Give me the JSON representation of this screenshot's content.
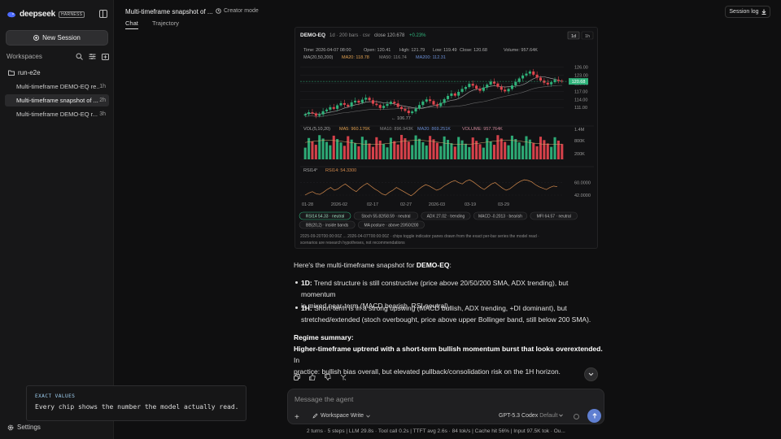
{
  "app": {
    "name": "deepseek",
    "badge": "HARNESS"
  },
  "sidebar": {
    "new_session": "New Session",
    "workspaces_label": "Workspaces",
    "folder": "run-e2e",
    "sessions": [
      {
        "title": "Multi-timeframe DEMO-EQ re...",
        "age": "1h",
        "active": false
      },
      {
        "title": "Multi-timeframe snapshot of ...",
        "age": "2h",
        "active": true
      },
      {
        "title": "Multi-timeframe DEMO-EQ r...",
        "age": "3h",
        "active": false
      }
    ],
    "settings": "Settings"
  },
  "header": {
    "title": "Multi-timeframe snapshot of ...",
    "creator_mode": "Creator mode",
    "tabs": [
      "Chat",
      "Trajectory"
    ],
    "session_log": "Session log"
  },
  "chart_data": {
    "type": "candlestick",
    "symbol": "DEMO-EQ",
    "meta": "1d · 200 bars · csv",
    "close_label": "close 120.678",
    "change": "+0.23%",
    "timeframes": [
      "1d",
      "1h"
    ],
    "info_row1": {
      "time": "Time: 2026-04-07 08:00",
      "open": "Open: 120.41",
      "high": "High: 121.79",
      "low": "Low: 119.49",
      "close": "Close: 120.68",
      "volume": "Volume: 957.64K"
    },
    "info_row2": {
      "ma": "MA(20,50,200)",
      "ma20": "MA20: 118.78",
      "ma50": "MA50: 116.74",
      "ma200": "MA200: 112.31"
    },
    "price_ticks": [
      "126.00",
      "123.00",
      "120.00",
      "117.00",
      "114.00",
      "111.00"
    ],
    "last_price": "120.68",
    "low_marker": "106.77",
    "volume_header": {
      "label": "VOL(5,10,20)",
      "ma5": "MA5: 960.176K",
      "ma10": "MA10: 896.943K",
      "ma20": "MA20: 869.251K",
      "volume": "VOLUME: 957.764K"
    },
    "volume_ticks": [
      "1.4M",
      "800K",
      "200K"
    ],
    "rsi_header": {
      "label": "RSI14°",
      "value": "RSI14: 54.3300"
    },
    "rsi_ticks": [
      "60.0000",
      "42.0000"
    ],
    "x_ticks": [
      "01-28",
      "2026-02",
      "02-17",
      "02-27",
      "2026-03",
      "03-19",
      "03-29"
    ],
    "close_series": [
      108.5,
      109.2,
      108.8,
      107.9,
      108.4,
      109.6,
      110.2,
      111.1,
      110.5,
      111.8,
      112.6,
      112.0,
      111.4,
      112.9,
      113.5,
      112.8,
      113.9,
      114.6,
      113.7,
      112.4,
      111.9,
      110.8,
      111.6,
      112.3,
      113.1,
      112.5,
      111.2,
      110.4,
      109.8,
      108.9,
      109.5,
      110.6,
      111.9,
      113.2,
      114.0,
      113.4,
      112.1,
      111.5,
      112.7,
      114.1,
      115.3,
      116.2,
      115.4,
      116.8,
      117.9,
      118.6,
      119.8,
      119.1,
      118.0,
      117.2,
      118.4,
      119.5,
      120.6,
      119.9,
      118.7,
      117.6,
      117.0,
      117.9,
      119.2,
      120.5,
      121.8,
      122.9,
      123.6,
      124.4,
      123.2,
      122.1,
      121.0,
      120.2,
      119.6,
      120.4,
      121.3,
      120.9,
      120.7
    ],
    "rsi_series": [
      42,
      45,
      47,
      44,
      43,
      46,
      50,
      53,
      49,
      51,
      55,
      58,
      54,
      50,
      47,
      52,
      56,
      59,
      55,
      51,
      48,
      44,
      42,
      46,
      49,
      53,
      50,
      47,
      44,
      41,
      45,
      50,
      54,
      57,
      55,
      52,
      49,
      51,
      55,
      58,
      61,
      63,
      60,
      58,
      62,
      64,
      61,
      57,
      53,
      50,
      54,
      58,
      60,
      56,
      52,
      49,
      51,
      55,
      59,
      62,
      64,
      63,
      61,
      57,
      54,
      52,
      50,
      53,
      55,
      54
    ],
    "chips": [
      {
        "text": "RSI14 54.33 · neutral",
        "accent": "#2fb27a"
      },
      {
        "text": "Stoch 55.82/58.59 · neutral",
        "accent": "#555"
      },
      {
        "text": "ADX 27.02 · trending",
        "accent": "#555"
      },
      {
        "text": "MACD -0.2013 · bearish",
        "accent": "#555"
      },
      {
        "text": "MFI 64.57 · neutral",
        "accent": "#555"
      },
      {
        "text": "BB(20,2) · inside bands",
        "accent": "#555"
      },
      {
        "text": "MA posture · above 20/50/200",
        "accent": "#555"
      }
    ],
    "footnote1": "2025-09-20T00:00:00Z ... 2026-04-07T00:00:00Z · chips toggle indicator panes drawn from the exact per-bar series the model read ·",
    "footnote2": "scenarios are research hypotheses, not recommendations",
    "colors": {
      "up": "#2fb27a",
      "down": "#e0454d",
      "ma": "#cfcfcf",
      "grid": "#1e1e20",
      "rsi": "#d48a4c"
    }
  },
  "message": {
    "intro_prefix": "Here's the multi-timeframe snapshot for ",
    "intro_symbol": "DEMO-EQ",
    "intro_suffix": ":",
    "b1_label": "1D:",
    "b1_text": " Trend structure is still constructive (price above 20/50/200 SMA, ADX trending), but momentum",
    "b1_text2": "is mixed near-term (MACD bearish, RSI neutral).",
    "b2_label": "1H:",
    "b2_text": " Short-term is in a strong upswing (MACD bullish, ADX trending, +DI dominant), but",
    "b2_text2": "stretched/extended (stoch overbought, price above upper Bollinger band, still below 200 SMA).",
    "regime_label": "Regime summary:",
    "regime_bold": "Higher-timeframe uptrend with a short-term bullish momentum burst that looks overextended.",
    "regime_text": " In",
    "regime_text2": "practice: bullish bias overall, but elevated pullback/consolidation risk on the 1H horizon."
  },
  "composer": {
    "placeholder": "Message the agent",
    "workspace": "Workspace Write",
    "model": "GPT-5.3 Codex",
    "model_suffix": "Default"
  },
  "stats": "2 turns · 5 steps   |   LLM 29.8s · Tool call 0.2s   |   TTFT avg 2.6s · 84 tok/s   |   Cache hit 56%   |   Input 97.5K tok · Ou...",
  "tip": {
    "title": "EXACT VALUES",
    "body": "Every chip shows the number the model actually read."
  }
}
